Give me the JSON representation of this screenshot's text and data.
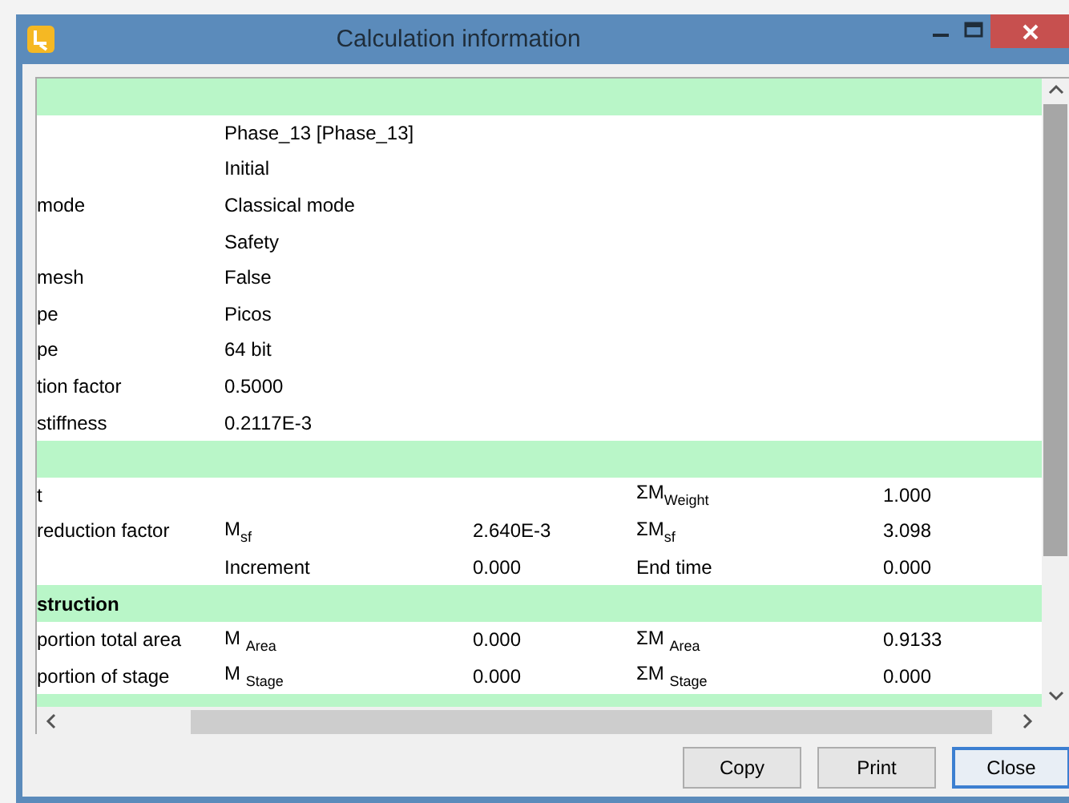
{
  "window": {
    "title": "Calculation information"
  },
  "rows": [
    {
      "kind": "section"
    },
    {
      "kind": "data",
      "value": "Phase_13 [Phase_13]"
    },
    {
      "kind": "data",
      "value": "Initial"
    },
    {
      "kind": "data",
      "label": "mode",
      "value": "Classical mode"
    },
    {
      "kind": "data",
      "value": "Safety"
    },
    {
      "kind": "data",
      "label": "mesh",
      "value": "False"
    },
    {
      "kind": "data",
      "label": "pe",
      "value": "Picos"
    },
    {
      "kind": "data",
      "label": "pe",
      "value": "64 bit"
    },
    {
      "kind": "data",
      "label": "tion factor",
      "value": "0.5000"
    },
    {
      "kind": "data",
      "label": "stiffness",
      "value": "0.2117E-3"
    },
    {
      "kind": "section"
    },
    {
      "kind": "data",
      "label": "t",
      "sum_symbol": "ΣM$_{Weight}$",
      "sum_value": "1.000"
    },
    {
      "kind": "data",
      "label": "reduction factor",
      "symbol": "M$_{sf}$",
      "value_3": "2.640E-3",
      "sum_symbol": "ΣM$_{sf}$",
      "sum_value": "3.098"
    },
    {
      "kind": "data",
      "symbol": "Increment",
      "value_3": "0.000",
      "sum_symbol": "End time",
      "sum_value": "0.000"
    },
    {
      "kind": "section",
      "title": "struction"
    },
    {
      "kind": "data",
      "label": "portion total area",
      "symbol": "M $_{Area}$",
      "value_3": "0.000",
      "sum_symbol": "ΣM $_{Area}$",
      "sum_value": "0.9133"
    },
    {
      "kind": "data",
      "label": "portion of stage",
      "symbol": "M $_{Stage}$",
      "value_3": "0.000",
      "sum_symbol": "ΣM $_{Stage}$",
      "sum_value": "0.000"
    },
    {
      "kind": "section"
    }
  ],
  "buttons": [
    {
      "label": "Copy",
      "default": false
    },
    {
      "label": "Print",
      "default": false
    },
    {
      "label": "Close",
      "default": true
    }
  ]
}
